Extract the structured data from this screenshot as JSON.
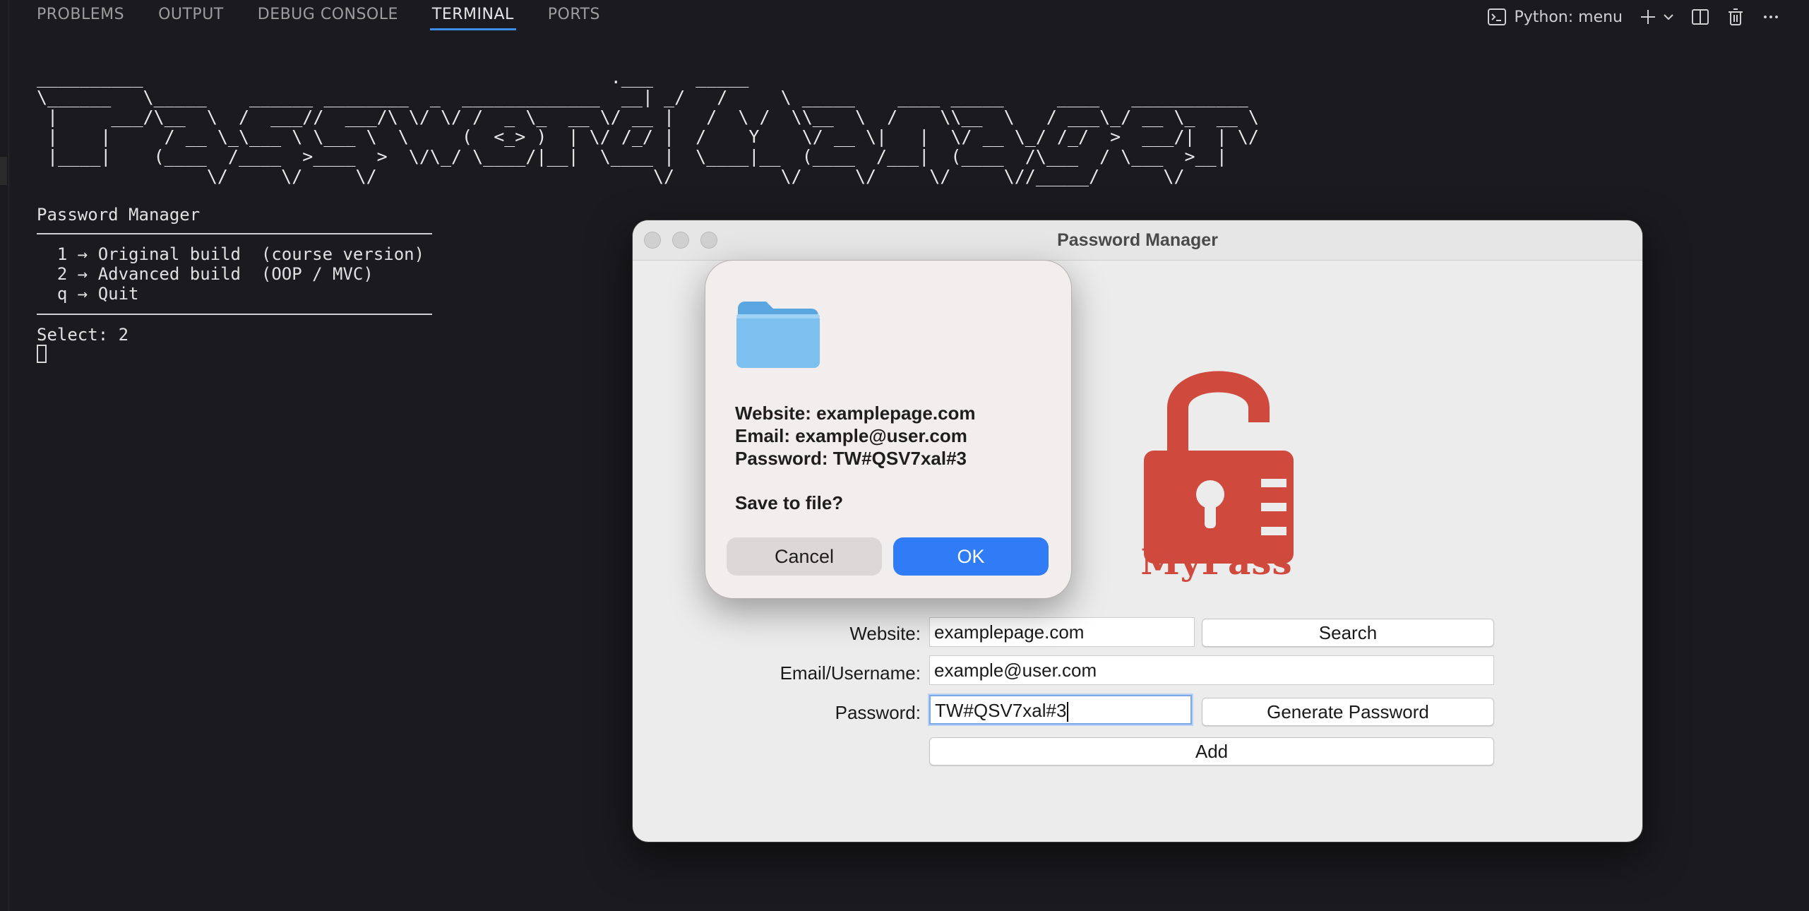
{
  "panel": {
    "tabs": [
      "PROBLEMS",
      "OUTPUT",
      "DEBUG CONSOLE",
      "TERMINAL",
      "PORTS"
    ],
    "active_tab": "TERMINAL",
    "terminal_profile": "Python: menu",
    "icons": [
      "terminal-icon",
      "plus-icon",
      "chevron-down-icon",
      "split-icon",
      "trash-icon",
      "ellipsis-icon"
    ]
  },
  "terminal": {
    "banner": "__________                                            .___    _____\n\\______   \\_____    ______ ________  _  _____________  __| _/   /     \\ _____    ____ _____     ____   ___________\n |     ___/\\__  \\  /  ___//  ___/\\ \\/ \\/ /  _ \\_  __ \\/ __ |   /  \\ /  \\\\__  \\  /    \\\\__  \\   / ___\\_/ __ \\_  __ \\\n |    |     / __ \\_\\___ \\ \\___ \\  \\     (  <_> )  | \\/ /_/ |  /    Y    \\/ __ \\|   |  \\/ __ \\_/ /_/  >  ___/|  | \\/\n |____|    (____  /____  >____  >  \\/\\_/ \\____/|__|  \\____ |  \\____|__  (____  /___|  (____  /\\___  / \\___  >__|\n                \\/     \\/     \\/                          \\/          \\/     \\/     \\/     \\//_____/      \\/",
    "menu_title": "Password Manager",
    "options": [
      "  1 → Original build  (course version)",
      "  2 → Advanced build  (OOP / MVC)",
      "  q → Quit"
    ],
    "prompt": "Select: 2"
  },
  "app": {
    "window_title": "Password Manager",
    "logo_text": "MyPass",
    "website_label": "Website:",
    "website_value": "examplepage.com",
    "search_label": "Search",
    "email_label": "Email/Username:",
    "email_value": "example@user.com",
    "password_label": "Password:",
    "password_value": "TW#QSV7xal#3",
    "generate_label": "Generate Password",
    "add_label": "Add",
    "logo_color": "#d0493d"
  },
  "dialog": {
    "line1": "Website: examplepage.com",
    "line2": "Email: example@user.com",
    "line3": "Password: TW#QSV7xal#3",
    "question": "Save to file?",
    "cancel_label": "Cancel",
    "ok_label": "OK",
    "ok_color": "#2f7cf6"
  }
}
